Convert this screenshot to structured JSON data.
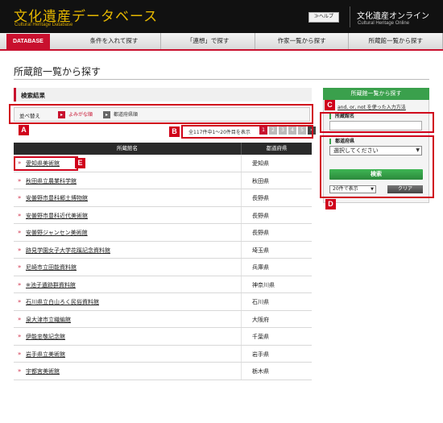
{
  "header": {
    "logo_jp": "文化遺産データベース",
    "logo_en": "Cultural Heritage Database",
    "help_label": "≫ヘルプ",
    "site_jp": "文化遺産オンライン",
    "site_en": "Cultural Heritage Online"
  },
  "nav": {
    "db_label": "DATABASE",
    "items": [
      {
        "label": "条件を入れて探す"
      },
      {
        "label": "「連想」で探す"
      },
      {
        "label": "作家一覧から探す"
      },
      {
        "label": "所蔵館一覧から探す"
      }
    ]
  },
  "page": {
    "title": "所蔵館一覧から探す"
  },
  "results": {
    "heading": "検索結果",
    "sort_label": "並べ替え",
    "sort_kana": "よみがな順",
    "sort_pref": "都道府県順",
    "pager_text": "全117件中1〜20件目を表示",
    "pages": [
      "1",
      "2",
      "3",
      "4",
      "5"
    ],
    "next": "»",
    "columns": {
      "name": "所蔵館名",
      "pref": "都道府県"
    },
    "rows": [
      {
        "name": "愛知県美術館",
        "pref": "愛知県"
      },
      {
        "name": "秋田県立農業科学館",
        "pref": "秋田県"
      },
      {
        "name": "安曇野市豊科郷土博物館",
        "pref": "長野県"
      },
      {
        "name": "安曇野市豊科近代美術館",
        "pref": "長野県"
      },
      {
        "name": "安曇野ジャンセン美術館",
        "pref": "長野県"
      },
      {
        "name": "跡見学園女子大学花蹊記念資料館",
        "pref": "埼玉県"
      },
      {
        "name": "尼崎市立田能資料館",
        "pref": "兵庫県"
      },
      {
        "name": "※池子遺跡群資料館",
        "pref": "神奈川県"
      },
      {
        "name": "石川県立白山ろく民俗資料館",
        "pref": "石川県"
      },
      {
        "name": "泉大津市立織編館",
        "pref": "大阪府"
      },
      {
        "name": "伊能忠敬記念館",
        "pref": "千葉県"
      },
      {
        "name": "岩手県立美術館",
        "pref": "岩手県"
      },
      {
        "name": "宇都宮美術館",
        "pref": "栃木県"
      }
    ]
  },
  "panel": {
    "heading": "所蔵館一覧から探す",
    "help_link": "and, or, not を使った入力方法",
    "name_label": "所蔵館名",
    "name_value": "",
    "pref_label": "都道府県",
    "pref_selected": "選択してください",
    "search_label": "検索",
    "count_selected": "20件で表示",
    "clear_label": "クリア"
  },
  "callouts": {
    "A": "A",
    "B": "B",
    "C": "C",
    "D": "D",
    "E": "E"
  },
  "colors": {
    "brand_red": "#c8102e",
    "accent_green": "#3aa04c",
    "logo_gold": "#e6b800",
    "callout_red": "#d0021b"
  }
}
